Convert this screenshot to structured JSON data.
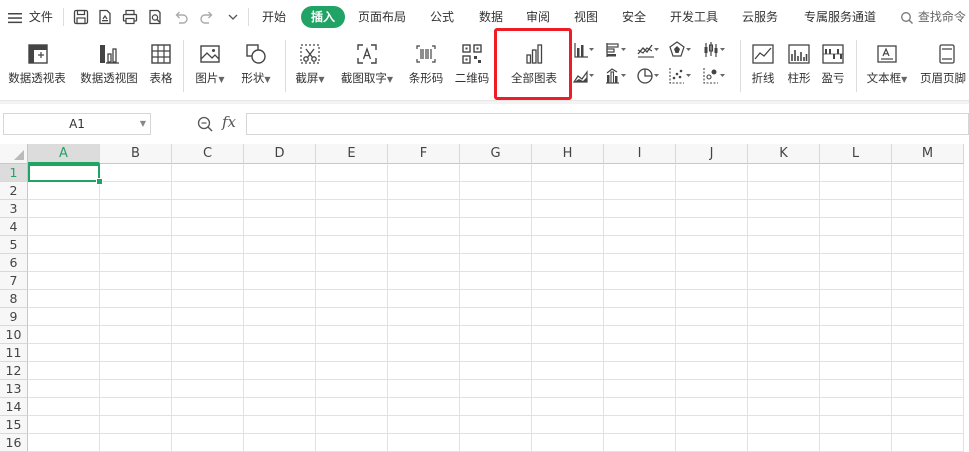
{
  "menu": {
    "file": "文件",
    "tabs": [
      {
        "label": "开始",
        "active": false
      },
      {
        "label": "插入",
        "active": true
      },
      {
        "label": "页面布局",
        "active": false
      },
      {
        "label": "公式",
        "active": false
      },
      {
        "label": "数据",
        "active": false
      },
      {
        "label": "审阅",
        "active": false
      },
      {
        "label": "视图",
        "active": false
      },
      {
        "label": "安全",
        "active": false
      },
      {
        "label": "开发工具",
        "active": false
      },
      {
        "label": "云服务",
        "active": false
      },
      {
        "label": "专属服务通道",
        "active": false
      }
    ],
    "search": "查找命令"
  },
  "ribbon": {
    "pivot_table": "数据透视表",
    "pivot_chart": "数据透视图",
    "table": "表格",
    "picture": "图片",
    "shape": "形状",
    "screenshot": "截屏",
    "screenshot_ocr": "截图取字",
    "barcode": "条形码",
    "qrcode": "二维码",
    "all_charts": "全部图表",
    "spark_line": "折线",
    "spark_column": "柱形",
    "spark_winloss": "盈亏",
    "textbox": "文本框",
    "header_footer": "页眉页脚"
  },
  "formula_bar": {
    "name_box": "A1",
    "fx": "fx",
    "value": ""
  },
  "sheet": {
    "columns": [
      "A",
      "B",
      "C",
      "D",
      "E",
      "F",
      "G",
      "H",
      "I",
      "J",
      "K",
      "L",
      "M"
    ],
    "rows": [
      "1",
      "2",
      "3",
      "4",
      "5",
      "6",
      "7",
      "8",
      "9",
      "10",
      "11",
      "12",
      "13",
      "14",
      "15",
      "16"
    ],
    "selected_cell": "A1"
  },
  "accent_color": "#21a366",
  "highlight_color": "#ee1c25"
}
